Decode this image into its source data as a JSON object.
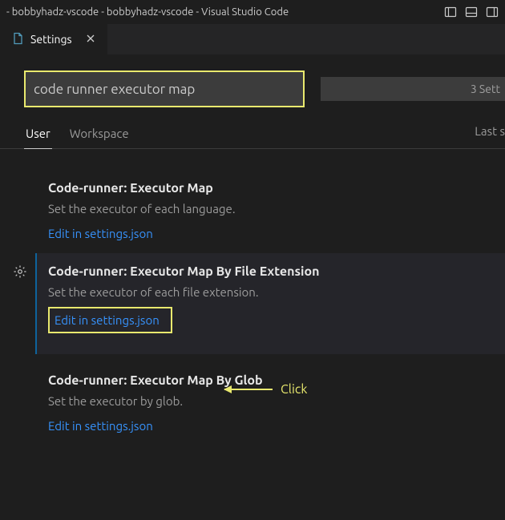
{
  "titlebar": {
    "title": "- bobbyhadz-vscode - bobbyhadz-vscode - Visual Studio Code"
  },
  "tab": {
    "label": "Settings"
  },
  "search": {
    "value": "code runner executor map",
    "result_count": "3 Sett"
  },
  "scope": {
    "user": "User",
    "workspace": "Workspace",
    "sync": "Last s"
  },
  "settings": [
    {
      "prefix": "Code-runner: ",
      "name": "Executor Map",
      "desc": "Set the executor of each language.",
      "link": "Edit in settings.json"
    },
    {
      "prefix": "Code-runner: ",
      "name": "Executor Map By File Extension",
      "desc": "Set the executor of each file extension.",
      "link": "Edit in settings.json"
    },
    {
      "prefix": "Code-runner: ",
      "name": "Executor Map By Glob",
      "desc": "Set the executor by glob.",
      "link": "Edit in settings.json"
    }
  ],
  "annotation": {
    "label": "Click"
  }
}
